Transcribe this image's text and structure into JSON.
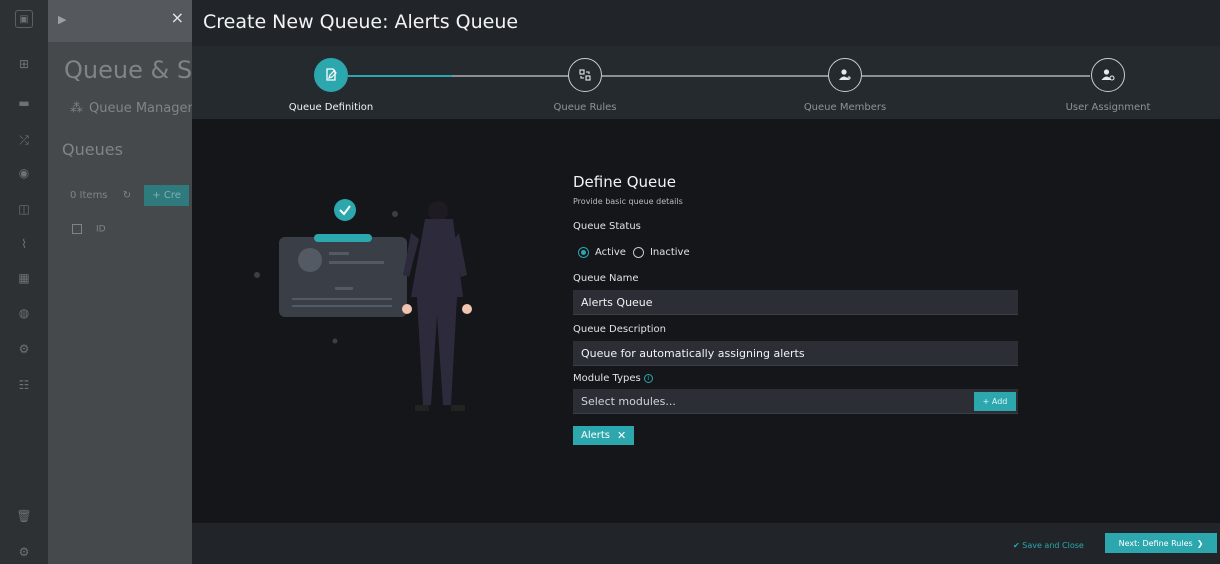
{
  "background": {
    "title": "Queue & S",
    "breadcrumb": "Queue Managem",
    "section": "Queues",
    "items_count": "0 Items",
    "create_label": "+ Cre",
    "id_header": "ID"
  },
  "modal": {
    "title": "Create New Queue: Alerts Queue",
    "steps": [
      {
        "label": "Queue Definition",
        "icon": "edit-doc-icon",
        "active": true
      },
      {
        "label": "Queue Rules",
        "icon": "rules-icon",
        "active": false
      },
      {
        "label": "Queue Members",
        "icon": "add-user-icon",
        "active": false
      },
      {
        "label": "User Assignment",
        "icon": "user-settings-icon",
        "active": false
      }
    ],
    "form": {
      "title": "Define Queue",
      "subtitle": "Provide basic queue details",
      "status_label": "Queue Status",
      "status_options": [
        "Active",
        "Inactive"
      ],
      "status_selected": "Active",
      "name_label": "Queue Name",
      "name_value": "Alerts Queue",
      "description_label": "Queue Description",
      "description_value": "Queue for automatically assigning alerts",
      "module_label": "Module Types",
      "module_placeholder": "Select modules...",
      "add_label": "+ Add",
      "tags": [
        "Alerts"
      ]
    },
    "footer": {
      "save_close": "Save and Close",
      "next": "Next: Define Rules"
    }
  },
  "colors": {
    "accent": "#2ba7ad",
    "modal_bg": "#14161a",
    "header_bg": "#212529"
  }
}
